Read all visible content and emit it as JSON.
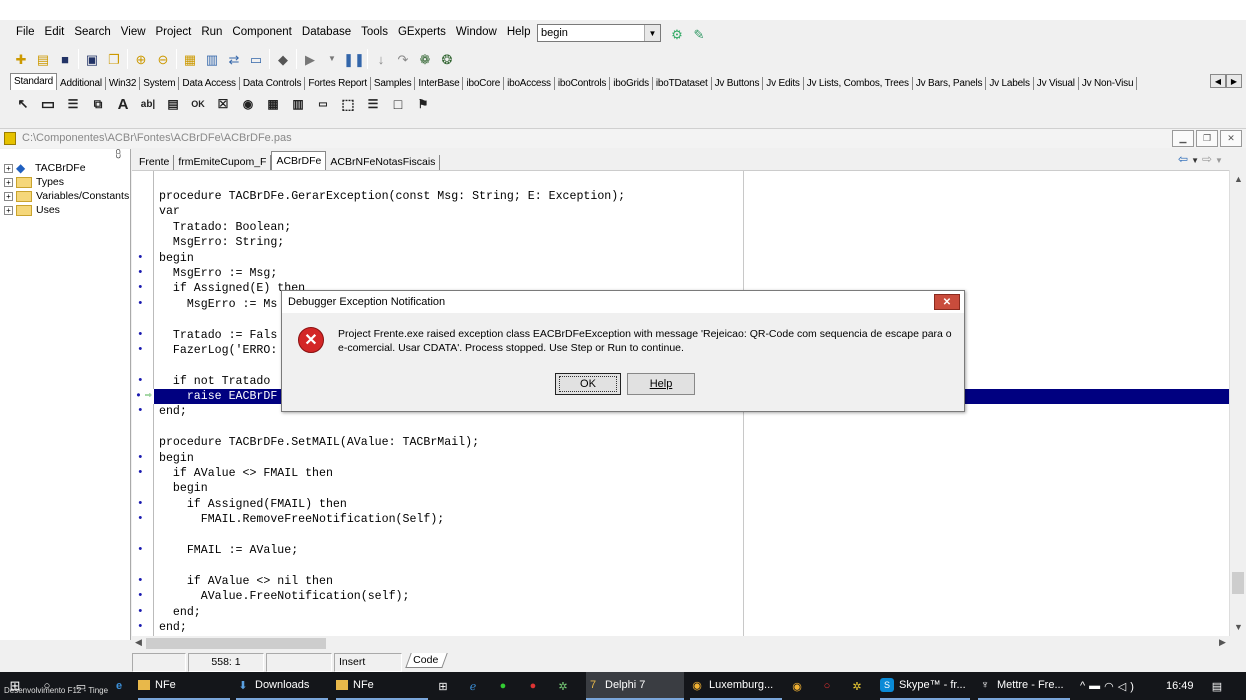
{
  "menu": [
    "File",
    "Edit",
    "Search",
    "View",
    "Project",
    "Run",
    "Component",
    "Database",
    "Tools",
    "GExperts",
    "Window",
    "Help"
  ],
  "search_combo": {
    "value": "begin"
  },
  "palette_tabs": [
    "Standard",
    "Additional",
    "Win32",
    "System",
    "Data Access",
    "Data Controls",
    "Fortes Report",
    "Samples",
    "InterBase",
    "iboCore",
    "iboAccess",
    "iboControls",
    "iboGrids",
    "iboTDataset",
    "Jv Buttons",
    "Jv Edits",
    "Jv Lists, Combos, Trees",
    "Jv Bars, Panels",
    "Jv Labels",
    "Jv Visual",
    "Jv Non-Visu"
  ],
  "editor_window": {
    "path": "C:\\Componentes\\ACBr\\Fontes\\ACBrDFe\\ACBrDFe.pas"
  },
  "explorer": {
    "root": "TACBrDFe",
    "nodes": [
      "Types",
      "Variables/Constants",
      "Uses"
    ]
  },
  "editor_tabs": [
    "Frente",
    "frmEmiteCupom_F",
    "ACBrDFe",
    "ACBrNFeNotasFiscais"
  ],
  "active_editor_tab": "ACBrDFe",
  "code_lines": [
    "procedure TACBrDFe.GerarException(const Msg: String; E: Exception);",
    "var",
    "  Tratado: Boolean;",
    "  MsgErro: String;",
    "begin",
    "  MsgErro := Msg;",
    "  if Assigned(E) then",
    "    MsgErro := Ms",
    "",
    "  Tratado := Fals",
    "  FazerLog('ERRO:",
    "",
    "  if not Tratado",
    "    raise EACBrDF",
    "end;",
    "",
    "procedure TACBrDFe.SetMAIL(AValue: TACBrMail);",
    "begin",
    "  if AValue <> FMAIL then",
    "  begin",
    "    if Assigned(FMAIL) then",
    "      FMAIL.RemoveFreeNotification(Self);",
    "",
    "    FMAIL := AValue;",
    "",
    "    if AValue <> nil then",
    "      AValue.FreeNotification(self);",
    "  end;",
    "end;"
  ],
  "code_dots": [
    false,
    false,
    false,
    false,
    true,
    true,
    true,
    true,
    false,
    true,
    true,
    false,
    true,
    true,
    true,
    false,
    false,
    true,
    true,
    false,
    true,
    true,
    false,
    true,
    false,
    true,
    true,
    true,
    true
  ],
  "status": {
    "position": "558:  1",
    "mode": "Insert",
    "code_tab": "Code"
  },
  "dialog": {
    "title": "Debugger Exception Notification",
    "message_line1": "Project Frente.exe raised exception class EACBrDFeException with message 'Rejeicao: QR-Code com sequencia de escape para o",
    "message_line2": "e-comercial. Usar CDATA'. Process stopped. Use Step or Run to continue.",
    "ok": "OK",
    "help": "Help"
  },
  "taskbar": {
    "items": [
      "NFe",
      "Downloads",
      "NFe",
      "Delphi 7",
      "Luxemburg...",
      "Skype™ - fr...",
      "Mettre - Fre..."
    ],
    "clock": "16:49",
    "overlay_text": "Desenvolvimento F12 - Tinge"
  },
  "colors": {
    "highlight": "#000080",
    "dialog_close": "#c94c3c",
    "taskbar": "#14161a"
  }
}
